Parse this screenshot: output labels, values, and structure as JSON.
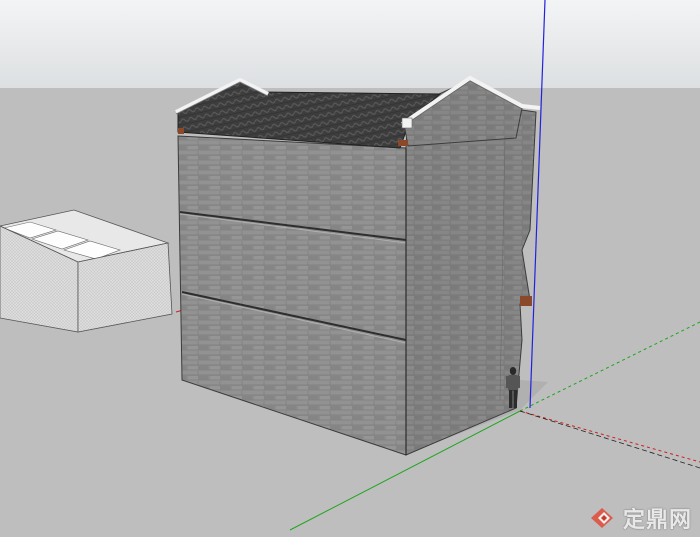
{
  "scene": {
    "description_label": "",
    "colors": {
      "sky_top": "#eef0f1",
      "sky_bottom": "#dfe2e4",
      "ground": "#bdbdbd",
      "wall_front": "#8a8a8a",
      "wall_side": "#7d7d7d",
      "roof_tiles": "#3f3f3f",
      "ridge": "#f4f4f4",
      "red_axis": "#d21e1e",
      "green_axis": "#1ea51e",
      "blue_axis": "#2222dd"
    }
  },
  "watermark": {
    "text": "定鼎网",
    "icon": "dingding-logo-icon"
  }
}
